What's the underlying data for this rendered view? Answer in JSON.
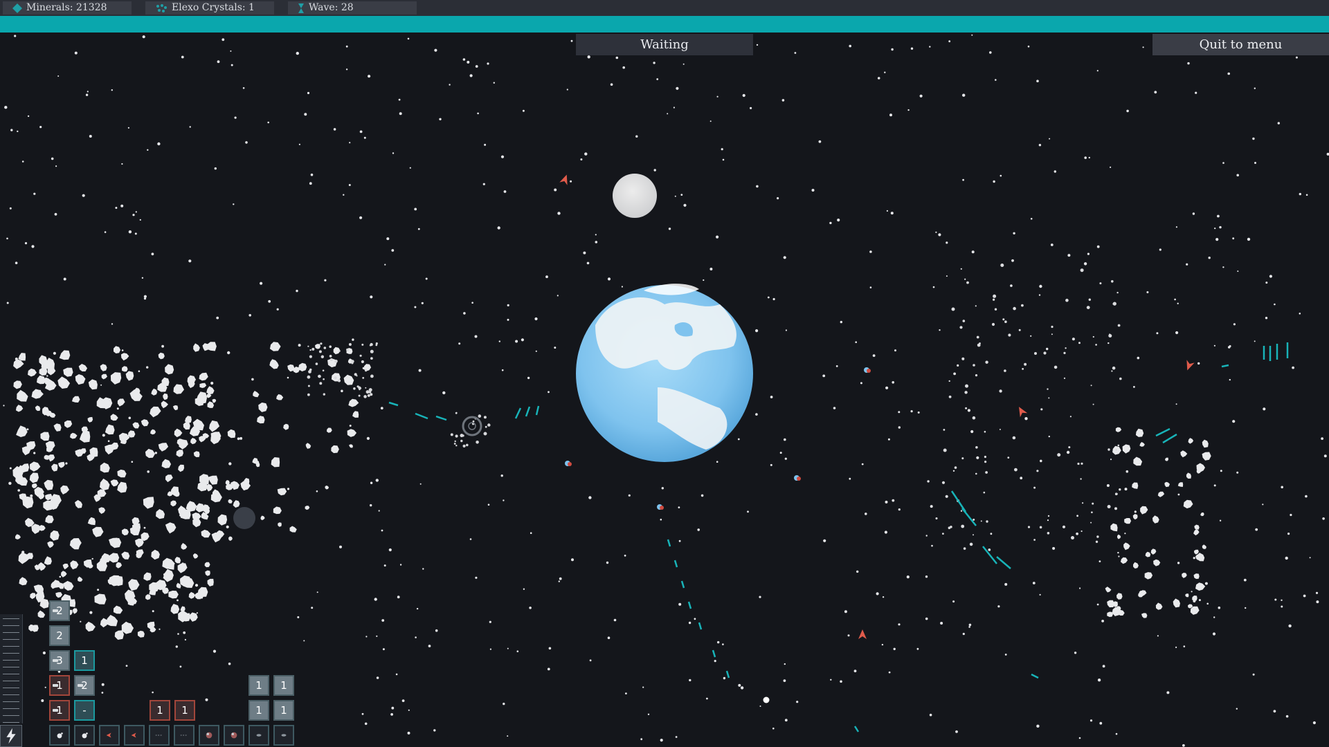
{
  "top_bar": {
    "minerals_label": "Minerals: 21328",
    "crystals_label": "Elexo Crystals: 1",
    "wave_label": "Wave: 28",
    "minerals_icon": "mineral-icon",
    "crystals_icon": "crystal-icon",
    "wave_icon": "hourglass-icon"
  },
  "wave_progress": 1.0,
  "game_state": "Waiting",
  "quit_label": "Quit to menu",
  "toolbar": {
    "stack_left": [
      "2",
      "2",
      "3",
      "1",
      "1"
    ],
    "stack_right": [
      "1",
      "2",
      "-"
    ],
    "red_slots": [
      "1",
      "1"
    ],
    "turret_grid": [
      "1",
      "1",
      "1",
      "1"
    ],
    "bottom_icons": [
      "mine-icon",
      "mine-icon",
      "missile-icon",
      "missile-icon",
      "beam-icon",
      "beam-icon",
      "cluster-icon",
      "cluster-icon",
      "drone-icon",
      "drone-icon"
    ],
    "power_icon": "lightning-icon"
  },
  "colors": {
    "background": "#14161b",
    "accent": "#0aa7ad",
    "enemy": "#e05b4b",
    "planet_ocean": "#7ec3ee",
    "planet_land": "#eef3f5"
  }
}
